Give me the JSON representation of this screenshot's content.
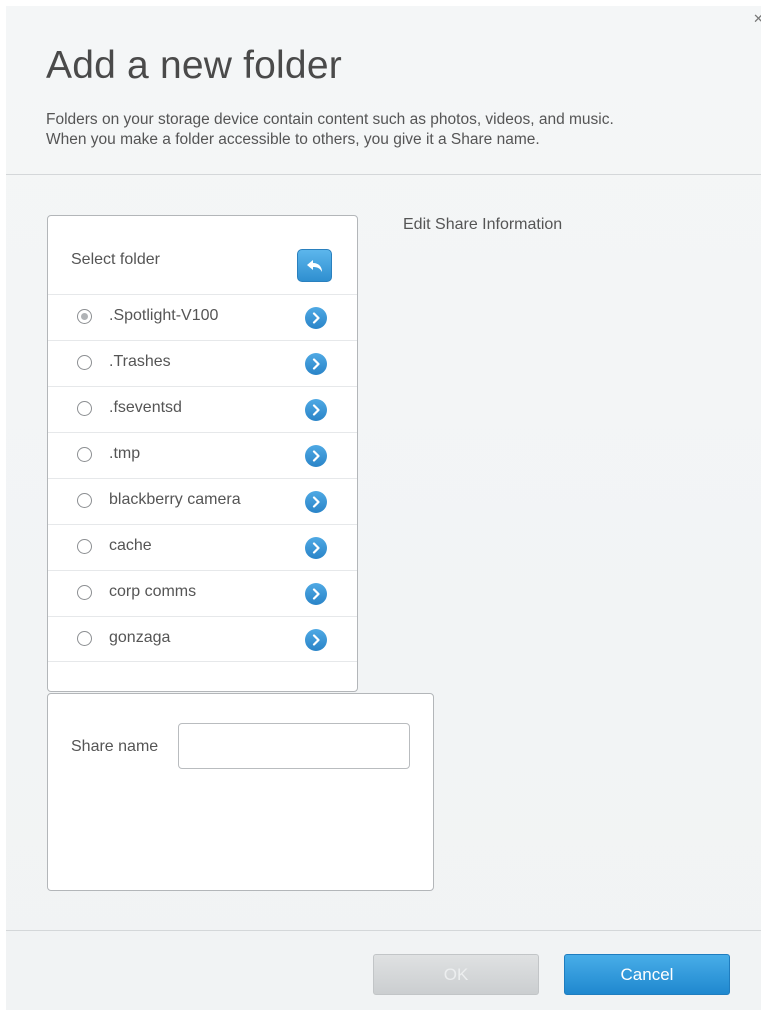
{
  "dialog": {
    "title": "Add a new folder",
    "description_line1": "Folders on your storage device contain content such as photos, videos, and music.",
    "description_line2": "When you make a folder accessible to others, you give it a Share name.",
    "close_icon": "close-icon"
  },
  "folder_panel": {
    "header_label": "Select folder",
    "back_icon": "back-arrow-icon",
    "folders": [
      {
        "name": ".Spotlight-V100",
        "selected": true
      },
      {
        "name": ".Trashes",
        "selected": false
      },
      {
        "name": ".fseventsd",
        "selected": false
      },
      {
        "name": ".tmp",
        "selected": false
      },
      {
        "name": "blackberry camera",
        "selected": false
      },
      {
        "name": "cache",
        "selected": false
      },
      {
        "name": "corp comms",
        "selected": false
      },
      {
        "name": "gonzaga",
        "selected": false
      }
    ]
  },
  "share_panel": {
    "label": "Share name",
    "value": "",
    "placeholder": ""
  },
  "edit_share_label": "Edit Share Information",
  "footer": {
    "ok_label": "OK",
    "cancel_label": "Cancel"
  },
  "colors": {
    "accent": "#2a84c8",
    "background": "#f2f4f5"
  }
}
